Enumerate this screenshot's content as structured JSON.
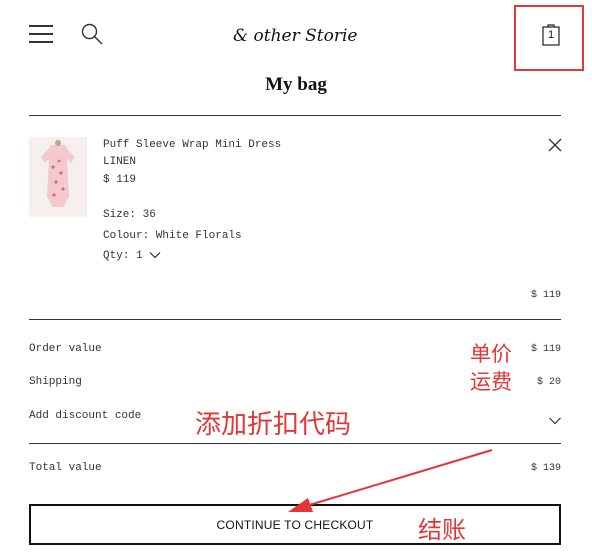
{
  "header": {
    "logo_text": "& other Stories",
    "bag_count": "1"
  },
  "page": {
    "title": "My bag"
  },
  "product": {
    "name": "Puff Sleeve Wrap Mini Dress",
    "material": "LINEN",
    "price": "$ 119",
    "size": "Size: 36",
    "colour": "Colour: White Florals",
    "qty": "Qty: 1",
    "line_total": "$ 119"
  },
  "summary": {
    "order_value_label": "Order value",
    "order_value": "$ 119",
    "shipping_label": "Shipping",
    "shipping_value": "$ 20",
    "discount_label": "Add discount code",
    "total_label": "Total value",
    "total_value": "$ 139"
  },
  "checkout": {
    "label": "CONTINUE TO CHECKOUT"
  },
  "annotations": {
    "unit_price": "单价",
    "shipping_fee": "运费",
    "add_discount": "添加折扣代码",
    "checkout": "结账"
  },
  "colors": {
    "annotation": "#e33636",
    "text": "#222222"
  }
}
